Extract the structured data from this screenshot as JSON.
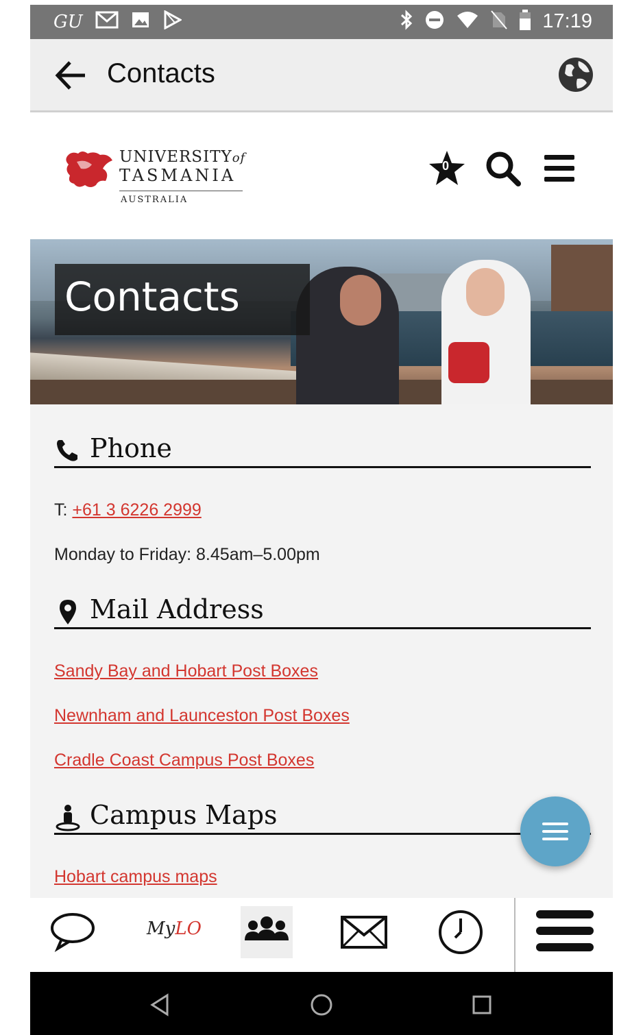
{
  "status_bar": {
    "carrier": "GU",
    "time": "17:19",
    "icons": [
      "gmail-icon",
      "image-icon",
      "play-store-icon",
      "bluetooth-icon",
      "do-not-disturb-icon",
      "wifi-icon",
      "no-sim-icon",
      "battery-icon"
    ]
  },
  "app_bar": {
    "title": "Contacts",
    "back_icon": "arrow-left-icon",
    "action_icon": "globe-icon"
  },
  "site_header": {
    "logo": {
      "line1": "UNIVERSITY",
      "line1_of": "of",
      "line2": "TASMANIA",
      "line3": "AUSTRALIA"
    },
    "favourites_count": "0",
    "icons": [
      "star-icon",
      "search-icon",
      "hamburger-menu-icon"
    ]
  },
  "hero": {
    "title": "Contacts"
  },
  "sections": {
    "phone": {
      "heading": "Phone",
      "icon": "phone-icon",
      "phone_prefix": "T:",
      "phone_number": "+61 3 6226 2999",
      "hours": "Monday to Friday: 8.45am–5.00pm"
    },
    "mail": {
      "heading": "Mail Address",
      "icon": "map-marker-icon",
      "links": [
        "Sandy Bay and Hobart Post Boxes",
        "Newnham and Launceston Post Boxes",
        "Cradle Coast Campus Post Boxes"
      ]
    },
    "maps": {
      "heading": "Campus Maps",
      "icon": "person-on-map-icon",
      "links": [
        "Hobart campus maps"
      ]
    }
  },
  "fab": {
    "icon": "menu-lines-icon"
  },
  "bottom_nav": {
    "items": [
      "chat-bubble-icon",
      "mylo-logo",
      "contacts-group-icon",
      "mail-icon",
      "clock-icon",
      "hamburger-menu-icon"
    ],
    "mylo_text_a": "My",
    "mylo_text_b": "LO",
    "active": "contacts-group-icon"
  },
  "system_nav": {
    "icons": [
      "back-triangle-icon",
      "home-circle-icon",
      "recents-square-icon"
    ]
  },
  "colors": {
    "link": "#d3362f",
    "fab": "#5ea5c8",
    "status_bar": "#757575",
    "app_bar": "#eeeeee",
    "brand_red": "#c9272d"
  }
}
